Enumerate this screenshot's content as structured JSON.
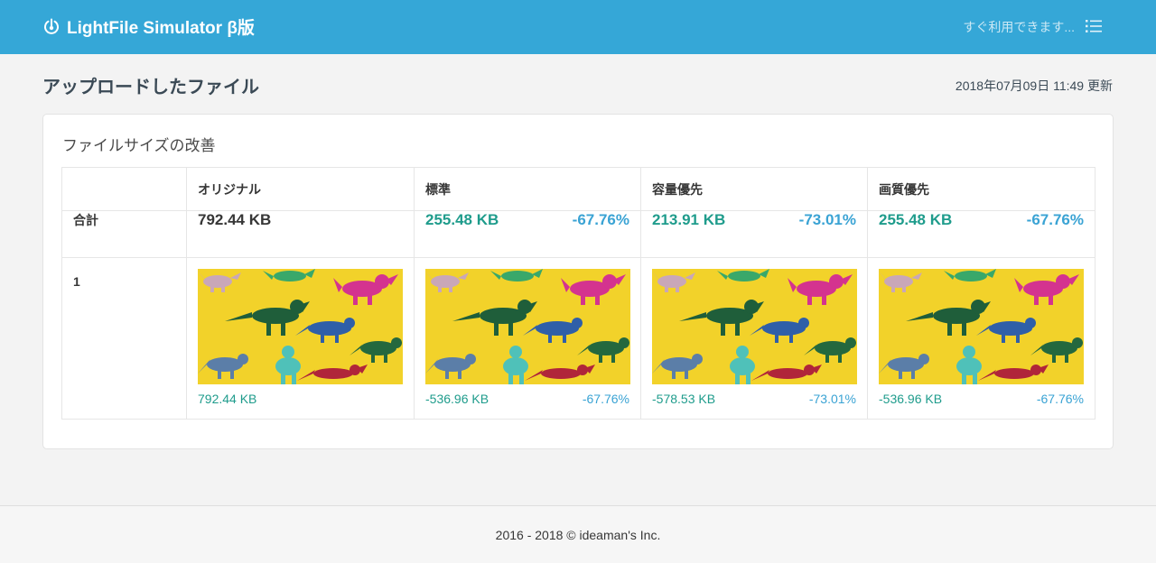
{
  "header": {
    "brand": "LightFile Simulator β版",
    "menu_text": "すぐ利用できます...",
    "brand_icon": "power-icon",
    "menu_icon": "list-icon"
  },
  "page": {
    "title": "アップロードしたファイル",
    "updated": "2018年07月09日 11:49 更新"
  },
  "card": {
    "title": "ファイルサイズの改善",
    "columns": [
      "",
      "オリジナル",
      "標準",
      "容量優先",
      "画質優先"
    ],
    "total": {
      "label": "合計",
      "original": "792.44 KB",
      "standard": {
        "size": "255.48 KB",
        "pct": "-67.76%"
      },
      "capacity": {
        "size": "213.91 KB",
        "pct": "-73.01%"
      },
      "quality": {
        "size": "255.48 KB",
        "pct": "-67.76%"
      }
    },
    "rows": [
      {
        "label": "1",
        "original": {
          "size": "792.44 KB"
        },
        "standard": {
          "size": "-536.96 KB",
          "pct": "-67.76%"
        },
        "capacity": {
          "size": "-578.53 KB",
          "pct": "-73.01%"
        },
        "quality": {
          "size": "-536.96 KB",
          "pct": "-67.76%"
        }
      }
    ]
  },
  "footer": {
    "text": "2016 - 2018 © ideaman's Inc."
  },
  "colors": {
    "header_bg": "#35a7d7",
    "size_green": "#1f9c8c",
    "pct_blue": "#3aa3d4",
    "thumb_bg": "#f2d22a"
  }
}
